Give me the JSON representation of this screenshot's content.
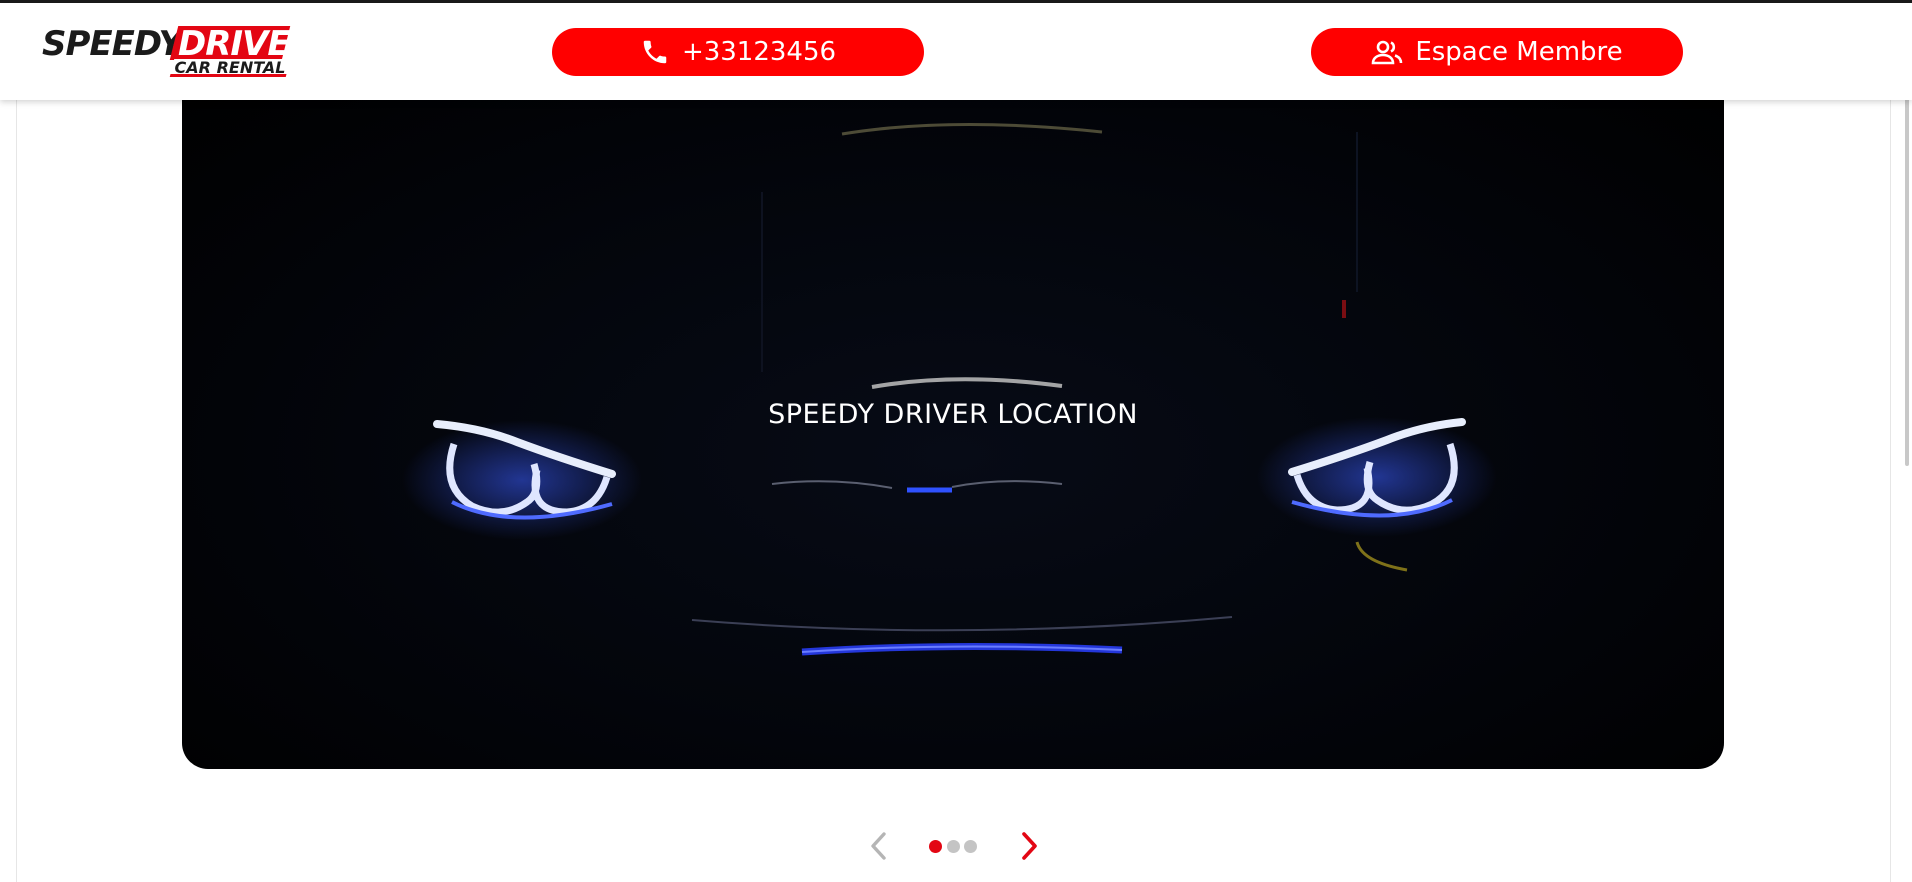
{
  "brand": {
    "logo_word1": "SPEEDY",
    "logo_word2": "DRIVE",
    "logo_tagline": "CAR RENTAL",
    "accent_color": "#ff0000"
  },
  "header": {
    "phone_label": "+33123456",
    "phone_icon": "phone-icon",
    "member_label": "Espace Membre",
    "member_icon": "users-icon"
  },
  "hero": {
    "title": "SPEEDY DRIVER LOCATION"
  },
  "carousel": {
    "active_index": 0,
    "dot_count": 3,
    "active_color": "#e30613",
    "inactive_color": "#c4c4c4",
    "prev_icon": "chevron-left-icon",
    "next_icon": "chevron-right-icon"
  }
}
